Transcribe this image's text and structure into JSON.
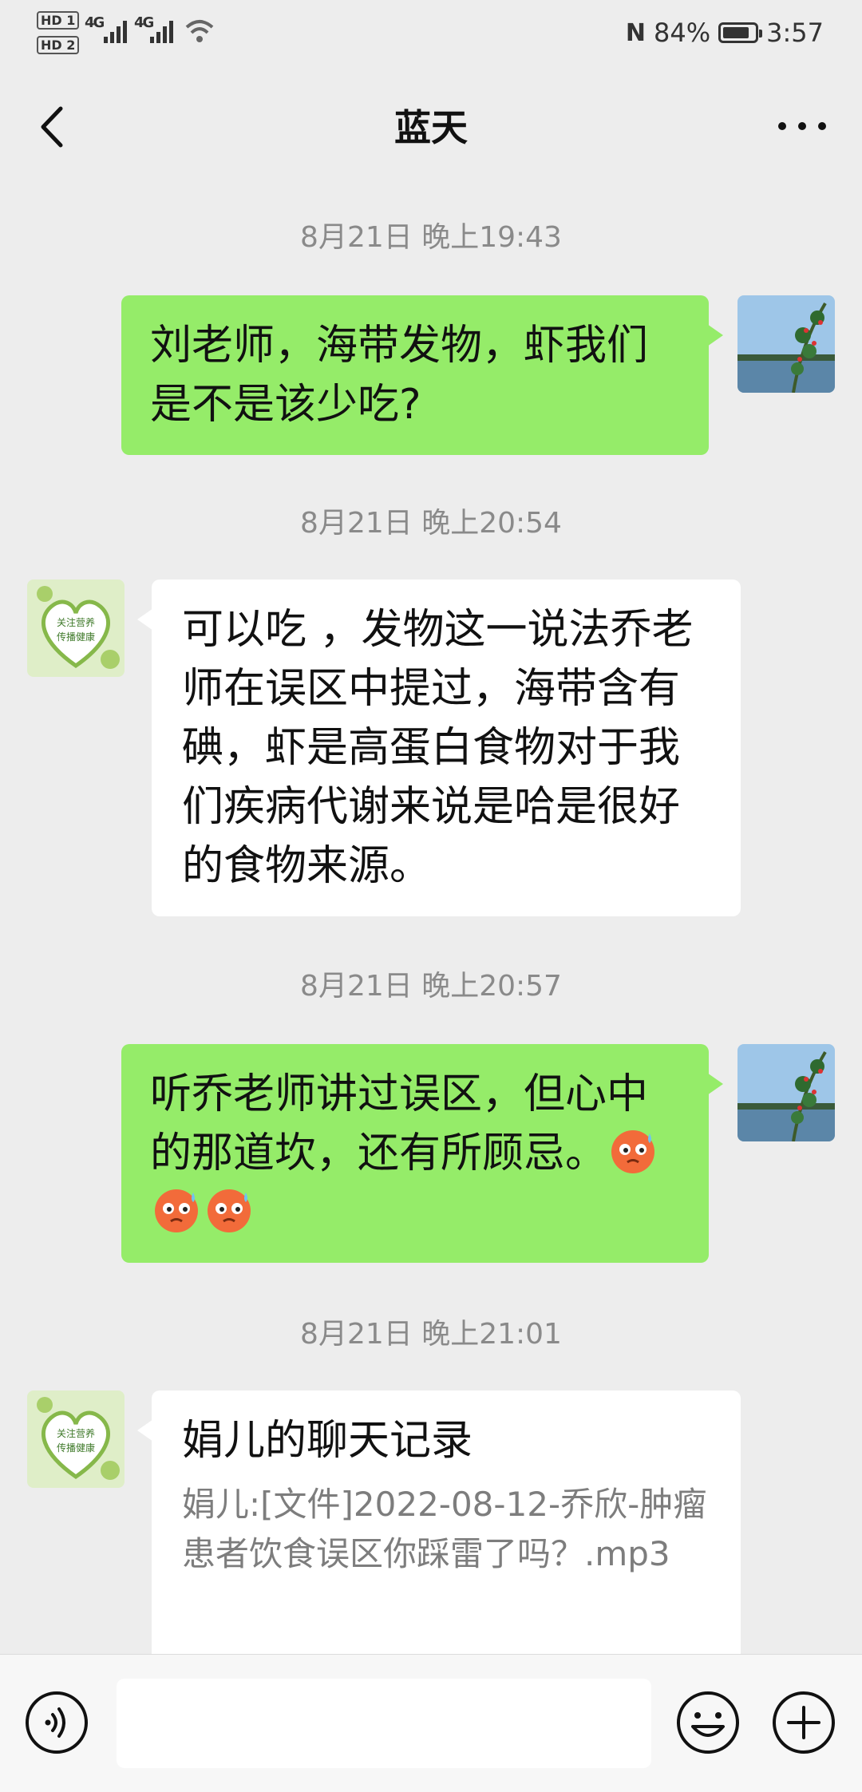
{
  "status_bar": {
    "hd1": "HD 1",
    "hd2": "HD 2",
    "sig1": "4G",
    "sig2": "4G",
    "nfc": "N",
    "battery_text": "84%",
    "battery_level": 0.84,
    "time": "3:57"
  },
  "header": {
    "title": "蓝天",
    "more_label": "···"
  },
  "messages": [
    {
      "time": "8月21日 晚上19:43",
      "from": "me",
      "text": "刘老师，海带发物，虾我们是不是该少吃?"
    },
    {
      "time": "8月21日 晚上20:54",
      "from": "other",
      "text": "可以吃 ，发物这一说法乔老师在误区中提过，海带含有碘，虾是高蛋白食物对于我们疾病代谢来说是哈是很好的食物来源。"
    },
    {
      "time": "8月21日 晚上20:57",
      "from": "me",
      "text": "听乔老师讲过误区，但心中的那道坎，还有所顾忌。"
    },
    {
      "time": "8月21日 晚上21:01",
      "from": "other",
      "record_title": "娟儿的聊天记录",
      "record_body": "娟儿:[文件]2022-08-12-乔欣-肿瘤患者饮食误区你踩雷了吗？.mp3"
    }
  ],
  "avatar_badge": [
    "关注营养",
    "传播健康"
  ],
  "colors": {
    "background": "#ededed",
    "my_bubble": "#95ec69",
    "other_bubble": "#ffffff",
    "timestamp": "#8a8a8a"
  },
  "icons": {
    "back": "chevron-left-icon",
    "more": "more-dots-icon",
    "voice": "voice-icon",
    "emoji": "emoji-smile-icon",
    "plus": "plus-icon",
    "sweat": "sweat-emoji"
  }
}
